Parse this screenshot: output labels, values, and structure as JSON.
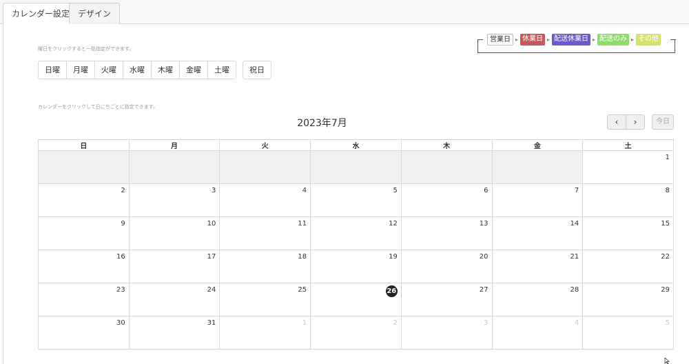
{
  "tabs": [
    {
      "label": "カレンダー設定",
      "active": true
    },
    {
      "label": "デザイン",
      "active": false
    }
  ],
  "weekday_hint": "曜日をクリックすると一括指定ができます。",
  "weekday_buttons": [
    "日曜",
    "月曜",
    "火曜",
    "水曜",
    "木曜",
    "金曜",
    "土曜"
  ],
  "holiday_button": "祝日",
  "legend": {
    "items": [
      {
        "label": "営業日",
        "color": "#ffffff",
        "text_color": "#333333"
      },
      {
        "label": "休業日",
        "color": "#c9585a",
        "text_color": "#ffffff"
      },
      {
        "label": "配送休業日",
        "color": "#6a5acd",
        "text_color": "#ffffff"
      },
      {
        "label": "配送のみ",
        "color": "#90dc6a",
        "text_color": "#ffffff"
      },
      {
        "label": "その他",
        "color": "#d8e26a",
        "text_color": "#ffffff"
      }
    ]
  },
  "calendar_hint": "カレンダーをクリックして日にちごとに指定できます。",
  "month_title": "2023年7月",
  "nav": {
    "prev": "‹",
    "next": "›",
    "today": "今日"
  },
  "weekday_headers": [
    "日",
    "月",
    "火",
    "水",
    "木",
    "金",
    "土"
  ],
  "weeks": [
    [
      {
        "d": "",
        "out": true
      },
      {
        "d": "",
        "out": true
      },
      {
        "d": "",
        "out": true
      },
      {
        "d": "",
        "out": true
      },
      {
        "d": "",
        "out": true
      },
      {
        "d": "",
        "out": true
      },
      {
        "d": "1"
      }
    ],
    [
      {
        "d": "2"
      },
      {
        "d": "3"
      },
      {
        "d": "4"
      },
      {
        "d": "5"
      },
      {
        "d": "6"
      },
      {
        "d": "7"
      },
      {
        "d": "8"
      }
    ],
    [
      {
        "d": "9"
      },
      {
        "d": "10"
      },
      {
        "d": "11"
      },
      {
        "d": "12"
      },
      {
        "d": "13"
      },
      {
        "d": "14"
      },
      {
        "d": "15"
      }
    ],
    [
      {
        "d": "16"
      },
      {
        "d": "17"
      },
      {
        "d": "18"
      },
      {
        "d": "19"
      },
      {
        "d": "20"
      },
      {
        "d": "21"
      },
      {
        "d": "22"
      }
    ],
    [
      {
        "d": "23"
      },
      {
        "d": "24"
      },
      {
        "d": "25"
      },
      {
        "d": "26",
        "today": true
      },
      {
        "d": "27"
      },
      {
        "d": "28"
      },
      {
        "d": "29"
      }
    ],
    [
      {
        "d": "30"
      },
      {
        "d": "31"
      },
      {
        "d": "1",
        "dim": true
      },
      {
        "d": "2",
        "dim": true
      },
      {
        "d": "3",
        "dim": true
      },
      {
        "d": "4",
        "dim": true
      },
      {
        "d": "5",
        "dim": true
      }
    ]
  ]
}
